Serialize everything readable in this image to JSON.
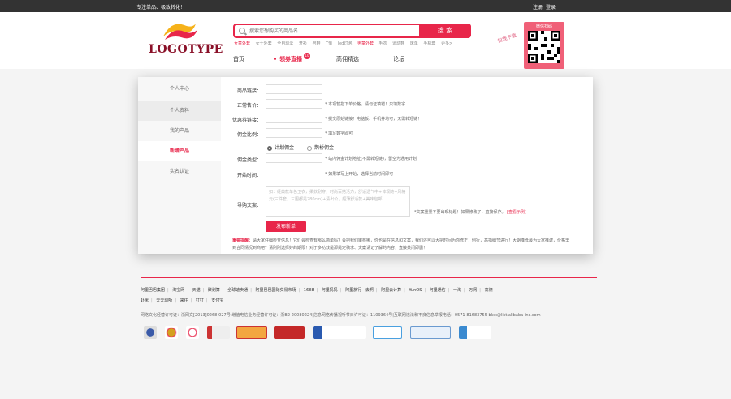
{
  "topbar": {
    "slogan": "专注单品、极致转化！",
    "login": "注册",
    "register": "登录"
  },
  "logo": {
    "text": "LOGOTYPE"
  },
  "search": {
    "placeholder": "搜索您想购买的商品名",
    "button": "搜 索"
  },
  "hotwords": [
    {
      "text": "女童外套",
      "hot": true
    },
    {
      "text": "女士外套",
      "hot": false
    },
    {
      "text": "全自动伞",
      "hot": false
    },
    {
      "text": "开衫",
      "hot": false
    },
    {
      "text": "男鞋",
      "hot": false
    },
    {
      "text": "T恤",
      "hot": false
    },
    {
      "text": "led灯泡",
      "hot": false
    },
    {
      "text": "男童外套",
      "hot": true
    },
    {
      "text": "毛衣",
      "hot": false
    },
    {
      "text": "运动鞋",
      "hot": false
    },
    {
      "text": "床单",
      "hot": false
    },
    {
      "text": "手机套",
      "hot": false
    },
    {
      "text": "更多>",
      "hot": false
    }
  ],
  "nav": {
    "home": "首页",
    "live": "领券直播",
    "live_badge": "10",
    "high": "高佣精选",
    "forum": "论坛"
  },
  "qr": {
    "title": "微信扫码",
    "tagline": "扫我下载"
  },
  "sidebar": {
    "items": [
      {
        "label": "个人中心"
      },
      {
        "label": "个人资料"
      },
      {
        "label": "我的产品"
      },
      {
        "label": "新增产品"
      },
      {
        "label": "实名认证"
      }
    ]
  },
  "form": {
    "product_link": {
      "label": "商品链接："
    },
    "price": {
      "label": "正常售价：",
      "tip": "* 本项暂指下单价格，请勿证填错！只填数字"
    },
    "coupon": {
      "label": "优惠券链接：",
      "tip": "* 提交原始链接！电脑板、手机券均可，无需转短链！"
    },
    "commission": {
      "label": "佣金比例：",
      "tip": "* 填写数字即可"
    },
    "radio_plan": "计划佣金",
    "radio_queqiao": "鹊桥佣金",
    "commission_type": {
      "label": "佣金类型：",
      "tip": "* 站内佣金计划地址(不需转短链)，留空为通用计划"
    },
    "start_time": {
      "label": "开始时间：",
      "tip": "* 如果填写上开始，选择当前时间即可"
    },
    "guide": {
      "label": "导购文案：",
      "placeholder": "如：经典款单色卫衣，柔软耐穿，时尚百搭活力，舒适透气中+体现随+风格元(三件套，三围都是280cm)+清出价，超薄舒适款+美味包邮...",
      "tip": "*文案重量不要出现标题！如果修改了，直接保存。",
      "tip_link": "[查看示例]"
    },
    "submit": "发布新单",
    "notice_label": "重要提醒：",
    "notice": "请大家仔细检查信息！它们会检查有那么简单吗？会把我们审核哪，你也是在信息和文案，我们还可以大把时间为你修正！例行，高指细节进行！大期降低最为大家推建，价格里到合同情况到商吧？请刚刚选择好的期限！对于多功效是那是定稿求、文案请记了解的内容，直接关闭即删！"
  },
  "footer": {
    "links": [
      "阿里巴巴集团",
      "淘宝网",
      "天猫",
      "聚划算",
      "全球速卖通",
      "阿里巴巴国际交易市场",
      "1688",
      "阿里妈妈",
      "阿里旅行 · 去啊",
      "阿里云计算",
      "YunOS",
      "阿里通信",
      "一淘",
      "万网",
      "高德",
      "虾米",
      "天天动听",
      "来往",
      "钉钉",
      "支付宝"
    ],
    "license": "网络文化经营许可证：浙网文[2013]0268-027号|增值电信业务经营许可证：浙B2-20080224|信息网络传播视听节目许可证：1109364号|互联网违法和不良信息举报电话：0571-81683755 blxx@list.alibaba-inc.com"
  }
}
